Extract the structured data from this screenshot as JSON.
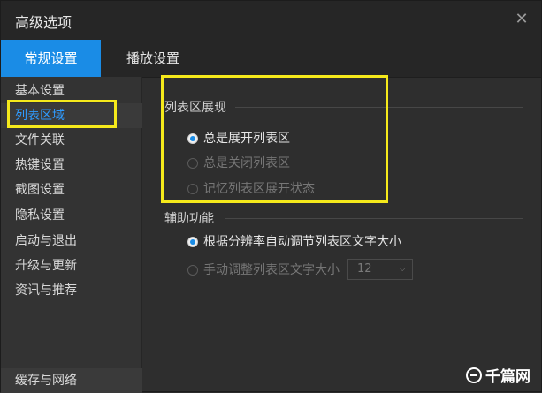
{
  "window": {
    "title": "高级选项",
    "close_glyph": "✕"
  },
  "tabs": [
    {
      "label": "常规设置",
      "active": true
    },
    {
      "label": "播放设置",
      "active": false
    }
  ],
  "sidebar": {
    "items": [
      {
        "label": "基本设置"
      },
      {
        "label": "列表区域"
      },
      {
        "label": "文件关联"
      },
      {
        "label": "热键设置"
      },
      {
        "label": "截图设置"
      },
      {
        "label": "隐私设置"
      },
      {
        "label": "启动与退出"
      },
      {
        "label": "升级与更新"
      },
      {
        "label": "资讯与推荐"
      }
    ],
    "bottom_item": "缓存与网络",
    "active_index": 1
  },
  "content": {
    "list_section": {
      "title": "列表区展现",
      "options": [
        {
          "label": "总是展开列表区",
          "checked": true,
          "disabled": false
        },
        {
          "label": "总是关闭列表区",
          "checked": false,
          "disabled": true
        },
        {
          "label": "记忆列表区展开状态",
          "checked": false,
          "disabled": true
        }
      ]
    },
    "assist_section": {
      "title": "辅助功能",
      "options": [
        {
          "label": "根据分辨率自动调节列表区文字大小",
          "checked": true,
          "disabled": false
        },
        {
          "label": "手动调整列表区文字大小",
          "checked": false,
          "disabled": true
        }
      ],
      "font_size_select": {
        "value": "12"
      }
    }
  },
  "watermark": {
    "text": "千篇网"
  },
  "colors": {
    "accent": "#1a8ce6",
    "highlight": "#f5e91b",
    "active_text": "#2f9bff"
  }
}
